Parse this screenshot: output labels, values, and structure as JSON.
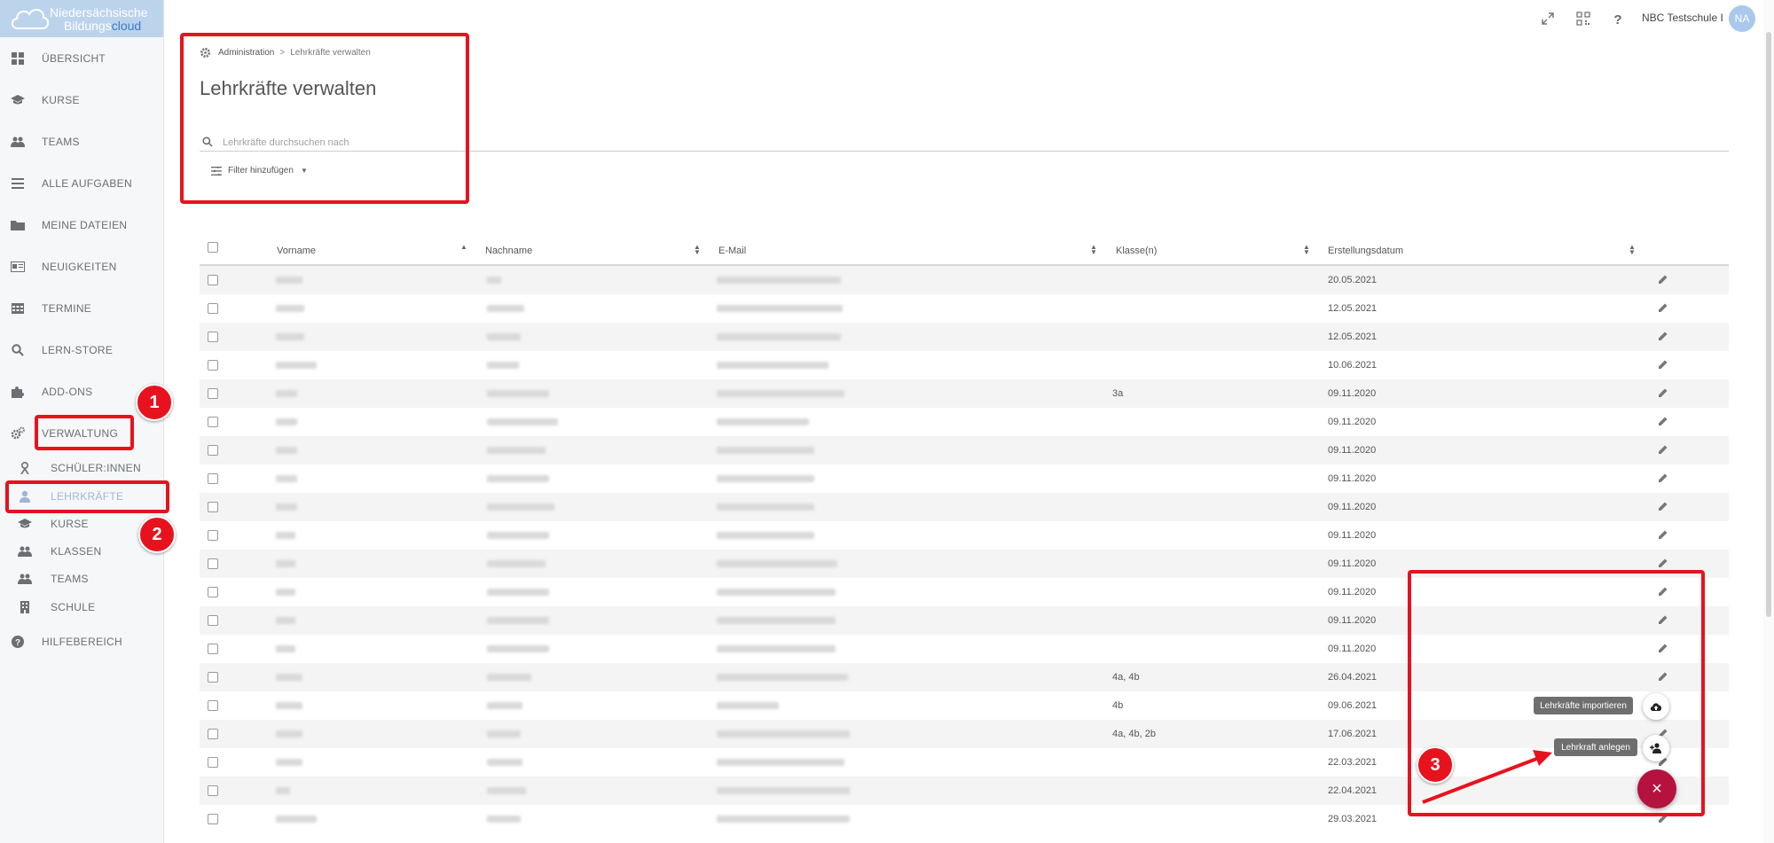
{
  "logo": {
    "line1": "Niedersächsische",
    "line2a": "Bildungs",
    "line2b": "cloud"
  },
  "sidebar": {
    "items": [
      {
        "label": "ÜBERSICHT",
        "icon": "dashboard-icon"
      },
      {
        "label": "KURSE",
        "icon": "graduation-cap-icon"
      },
      {
        "label": "TEAMS",
        "icon": "users-icon"
      },
      {
        "label": "ALLE AUFGABEN",
        "icon": "tasks-icon"
      },
      {
        "label": "MEINE DATEIEN",
        "icon": "folder-icon"
      },
      {
        "label": "NEUIGKEITEN",
        "icon": "news-icon"
      },
      {
        "label": "TERMINE",
        "icon": "calendar-icon"
      },
      {
        "label": "LERN-STORE",
        "icon": "search-icon"
      },
      {
        "label": "ADD-ONS",
        "icon": "puzzle-icon"
      },
      {
        "label": "VERWALTUNG",
        "icon": "cogs-icon"
      }
    ],
    "subitems": [
      {
        "label": "SCHÜLER:INNEN",
        "icon": "student-icon"
      },
      {
        "label": "LEHRKRÄFTE",
        "icon": "teacher-icon"
      },
      {
        "label": "KURSE",
        "icon": "graduation-cap-icon"
      },
      {
        "label": "KLASSEN",
        "icon": "users-icon"
      },
      {
        "label": "TEAMS",
        "icon": "users-icon"
      },
      {
        "label": "SCHULE",
        "icon": "building-icon"
      }
    ],
    "help": {
      "label": "HILFEBEREICH",
      "icon": "help-circle-icon"
    }
  },
  "header": {
    "school_name": "NBC Testschule I",
    "avatar_initials": "NA"
  },
  "breadcrumb": {
    "root": "Administration",
    "current": "Lehrkräfte verwalten"
  },
  "page_title": "Lehrkräfte verwalten",
  "search": {
    "placeholder": "Lehrkräfte durchsuchen nach",
    "value": ""
  },
  "filter": {
    "label": "Filter hinzufügen"
  },
  "table": {
    "columns": [
      "Vorname",
      "Nachname",
      "E-Mail",
      "Klasse(n)",
      "Erstellungsdatum"
    ],
    "rows": [
      {
        "klassen": "",
        "datum": "20.05.2021"
      },
      {
        "klassen": "",
        "datum": "12.05.2021"
      },
      {
        "klassen": "",
        "datum": "12.05.2021"
      },
      {
        "klassen": "",
        "datum": "10.06.2021"
      },
      {
        "klassen": "3a",
        "datum": "09.11.2020"
      },
      {
        "klassen": "",
        "datum": "09.11.2020"
      },
      {
        "klassen": "",
        "datum": "09.11.2020"
      },
      {
        "klassen": "",
        "datum": "09.11.2020"
      },
      {
        "klassen": "",
        "datum": "09.11.2020"
      },
      {
        "klassen": "",
        "datum": "09.11.2020"
      },
      {
        "klassen": "",
        "datum": "09.11.2020"
      },
      {
        "klassen": "",
        "datum": "09.11.2020"
      },
      {
        "klassen": "",
        "datum": "09.11.2020"
      },
      {
        "klassen": "",
        "datum": "09.11.2020"
      },
      {
        "klassen": "4a, 4b",
        "datum": "26.04.2021"
      },
      {
        "klassen": "4b",
        "datum": "09.06.2021"
      },
      {
        "klassen": "4a, 4b, 2b",
        "datum": "17.06.2021"
      },
      {
        "klassen": "",
        "datum": "22.03.2021"
      },
      {
        "klassen": "",
        "datum": "22.04.2021"
      },
      {
        "klassen": "",
        "datum": "29.03.2021"
      }
    ]
  },
  "fab": {
    "import_label": "Lehrkräfte importieren",
    "create_label": "Lehrkraft anlegen",
    "close_symbol": "×"
  },
  "annotations": {
    "n1": "1",
    "n2": "2",
    "n3": "3"
  },
  "colors": {
    "accent": "#b5123f",
    "annotation": "#e8121e",
    "active_sub": "#9cb7d5"
  }
}
